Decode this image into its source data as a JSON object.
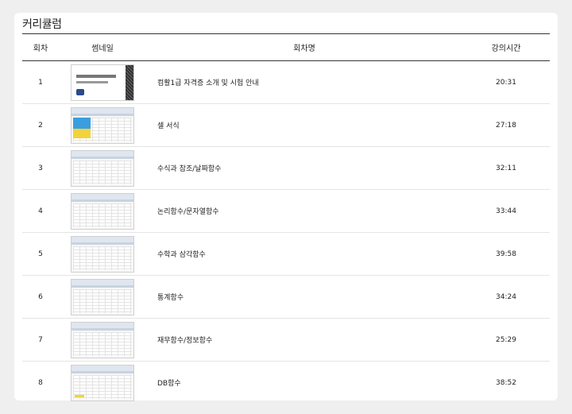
{
  "section": {
    "title": "커리큘럼"
  },
  "table": {
    "headers": {
      "no": "회차",
      "thumb": "썸네일",
      "name": "회차명",
      "time": "강의시간"
    },
    "rows": [
      {
        "no": "1",
        "name": "컴활1급 자격증 소개 및 시험 안내",
        "time": "20:31",
        "thumb_style": "title-slide"
      },
      {
        "no": "2",
        "name": "셀 서식",
        "time": "27:18",
        "thumb_style": "color-cells"
      },
      {
        "no": "3",
        "name": "수식과 참조/날짜함수",
        "time": "32:11",
        "thumb_style": "spreadsheet"
      },
      {
        "no": "4",
        "name": "논리함수/문자열함수",
        "time": "33:44",
        "thumb_style": "spreadsheet"
      },
      {
        "no": "5",
        "name": "수학과 삼각함수",
        "time": "39:58",
        "thumb_style": "spreadsheet"
      },
      {
        "no": "6",
        "name": "통계함수",
        "time": "34:24",
        "thumb_style": "spreadsheet"
      },
      {
        "no": "7",
        "name": "재무함수/정보함수",
        "time": "25:29",
        "thumb_style": "spreadsheet"
      },
      {
        "no": "8",
        "name": "DB함수",
        "time": "38:52",
        "thumb_style": "spreadsheet-yellow"
      }
    ]
  }
}
